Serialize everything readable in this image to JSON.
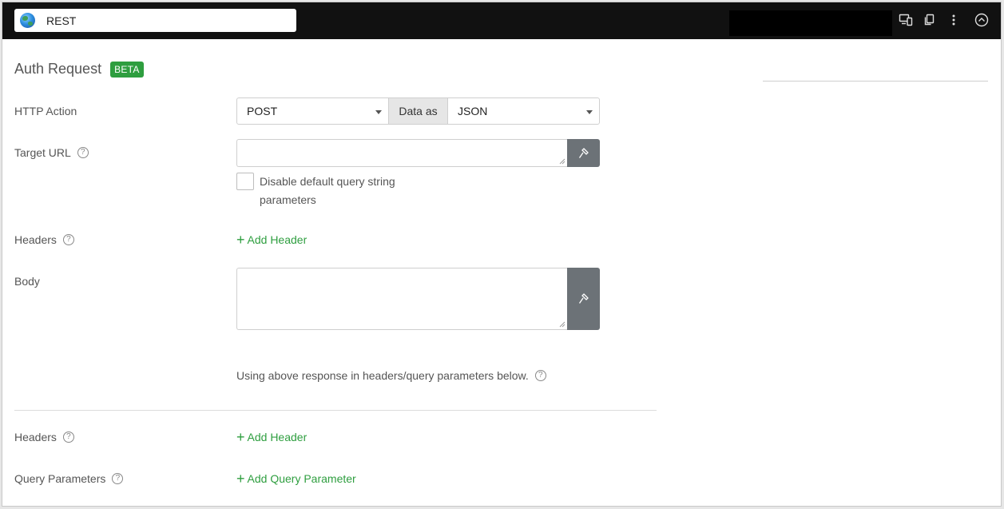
{
  "topbar": {
    "step_name": "REST",
    "icons": [
      "devices-icon",
      "copy-icon",
      "more-vertical-icon",
      "collapse-up-icon"
    ]
  },
  "section": {
    "title": "Auth Request",
    "badge": "BETA"
  },
  "form": {
    "http_action_label": "HTTP Action",
    "http_action_value": "POST",
    "data_as_label": "Data as",
    "data_as_value": "JSON",
    "target_url_label": "Target URL",
    "target_url_value": "",
    "disable_query_label": "Disable default query string parameters",
    "headers_label": "Headers",
    "add_header_label": "Add Header",
    "body_label": "Body",
    "body_value": "",
    "response_note": "Using above response in headers/query parameters below."
  },
  "lower": {
    "headers_label": "Headers",
    "add_header_label": "Add Header",
    "query_params_label": "Query Parameters",
    "add_query_param_label": "Add Query Parameter"
  },
  "colors": {
    "accent_green": "#2e9e3f",
    "topbar_bg": "#111111",
    "button_gray": "#6c7277"
  }
}
